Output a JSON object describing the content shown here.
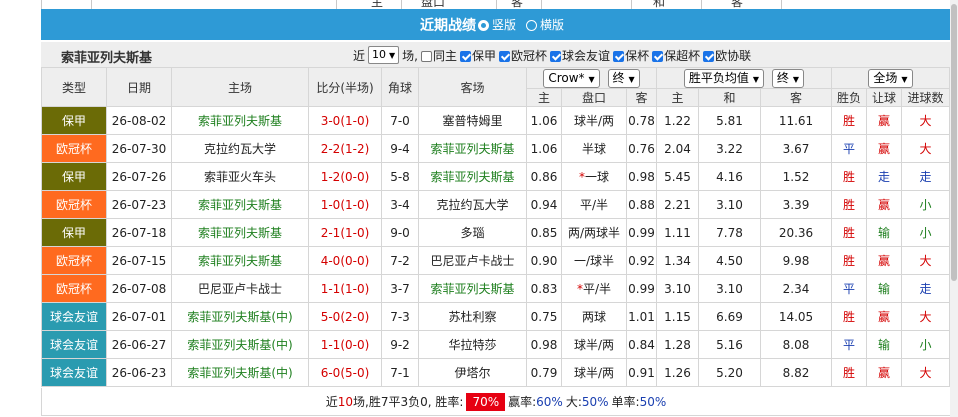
{
  "top_stub": {
    "labels": [
      "主",
      "盘口",
      "客",
      "和",
      "客"
    ]
  },
  "title_bar": {
    "title": "近期战绩",
    "option_vertical": "竖版",
    "option_horizontal": "横版"
  },
  "header": {
    "team": "索菲亚列夫斯基",
    "recent_label": "近",
    "count_value": "10",
    "count_unit": "场,",
    "checkboxes": [
      {
        "label": "同主",
        "checked": false
      },
      {
        "label": "保甲",
        "checked": true
      },
      {
        "label": "欧冠杯",
        "checked": true
      },
      {
        "label": "球会友谊",
        "checked": true
      },
      {
        "label": "保杯",
        "checked": true
      },
      {
        "label": "保超杯",
        "checked": true
      },
      {
        "label": "欧协联",
        "checked": false
      }
    ]
  },
  "columns": {
    "type": "类型",
    "date": "日期",
    "home": "主场",
    "score": "比分(半场)",
    "corner": "角球",
    "away": "客场",
    "company_select": "Crow*",
    "ah_time_select": "终",
    "euro_select": "胜平负均值",
    "euro_time_select": "终",
    "scope_select": "全场",
    "ah_home": "主",
    "ah_line": "盘口",
    "ah_away": "客",
    "eu_home": "主",
    "eu_draw": "和",
    "eu_away": "客",
    "result": "胜负",
    "handicap_result": "让球",
    "goals": "进球数"
  },
  "rows": [
    {
      "league": "保甲",
      "league_color": "#6b6b06",
      "date": "26-08-02",
      "home": "索菲亚列夫斯基",
      "home_green": true,
      "score": "3-0(1-0)",
      "corner": "7-0",
      "away": "塞普特姆里",
      "away_green": false,
      "ah_h": "1.06",
      "ah_line": "球半/两",
      "ah_star": false,
      "ah_a": "0.78",
      "eu_h": "1.22",
      "eu_d": "5.81",
      "eu_a": "11.61",
      "res": "胜",
      "hc": "赢",
      "ou": "大"
    },
    {
      "league": "欧冠杯",
      "league_color": "#ff6a1f",
      "date": "26-07-30",
      "home": "克拉约瓦大学",
      "home_green": false,
      "score": "2-2(1-2)",
      "corner": "9-4",
      "away": "索菲亚列夫斯基",
      "away_green": true,
      "ah_h": "1.06",
      "ah_line": "半球",
      "ah_star": false,
      "ah_a": "0.76",
      "eu_h": "2.04",
      "eu_d": "3.22",
      "eu_a": "3.67",
      "res": "平",
      "hc": "赢",
      "ou": "大"
    },
    {
      "league": "保甲",
      "league_color": "#6b6b06",
      "date": "26-07-26",
      "home": "索菲亚火车头",
      "home_green": false,
      "score": "1-2(0-0)",
      "corner": "5-8",
      "away": "索菲亚列夫斯基",
      "away_green": true,
      "ah_h": "0.86",
      "ah_line": "一球",
      "ah_star": true,
      "ah_a": "0.98",
      "eu_h": "5.45",
      "eu_d": "4.16",
      "eu_a": "1.52",
      "res": "胜",
      "hc": "走",
      "ou": "走"
    },
    {
      "league": "欧冠杯",
      "league_color": "#ff6a1f",
      "date": "26-07-23",
      "home": "索菲亚列夫斯基",
      "home_green": true,
      "score": "1-0(1-0)",
      "corner": "3-4",
      "away": "克拉约瓦大学",
      "away_green": false,
      "ah_h": "0.94",
      "ah_line": "平/半",
      "ah_star": false,
      "ah_a": "0.88",
      "eu_h": "2.21",
      "eu_d": "3.10",
      "eu_a": "3.39",
      "res": "胜",
      "hc": "赢",
      "ou": "小"
    },
    {
      "league": "保甲",
      "league_color": "#6b6b06",
      "date": "26-07-18",
      "home": "索菲亚列夫斯基",
      "home_green": true,
      "score": "2-1(1-0)",
      "corner": "9-0",
      "away": "多瑙",
      "away_green": false,
      "ah_h": "0.85",
      "ah_line": "两/两球半",
      "ah_star": false,
      "ah_a": "0.99",
      "eu_h": "1.11",
      "eu_d": "7.78",
      "eu_a": "20.36",
      "res": "胜",
      "hc": "输",
      "ou": "小"
    },
    {
      "league": "欧冠杯",
      "league_color": "#ff6a1f",
      "date": "26-07-15",
      "home": "索菲亚列夫斯基",
      "home_green": true,
      "score": "4-0(0-0)",
      "corner": "7-2",
      "away": "巴尼亚卢卡战士",
      "away_green": false,
      "ah_h": "0.90",
      "ah_line": "一/球半",
      "ah_star": false,
      "ah_a": "0.92",
      "eu_h": "1.34",
      "eu_d": "4.50",
      "eu_a": "9.98",
      "res": "胜",
      "hc": "赢",
      "ou": "大"
    },
    {
      "league": "欧冠杯",
      "league_color": "#ff6a1f",
      "date": "26-07-08",
      "home": "巴尼亚卢卡战士",
      "home_green": false,
      "score": "1-1(1-0)",
      "corner": "3-7",
      "away": "索菲亚列夫斯基",
      "away_green": true,
      "ah_h": "0.83",
      "ah_line": "平/半",
      "ah_star": true,
      "ah_a": "0.99",
      "eu_h": "3.10",
      "eu_d": "3.10",
      "eu_a": "2.34",
      "res": "平",
      "hc": "输",
      "ou": "走"
    },
    {
      "league": "球会友谊",
      "league_color": "#2a9bb0",
      "date": "26-07-01",
      "home": "索菲亚列夫斯基(中)",
      "home_green": true,
      "score": "5-0(2-0)",
      "corner": "7-3",
      "away": "苏杜利察",
      "away_green": false,
      "ah_h": "0.75",
      "ah_line": "两球",
      "ah_star": false,
      "ah_a": "1.01",
      "eu_h": "1.15",
      "eu_d": "6.69",
      "eu_a": "14.05",
      "res": "胜",
      "hc": "赢",
      "ou": "大"
    },
    {
      "league": "球会友谊",
      "league_color": "#2a9bb0",
      "date": "26-06-27",
      "home": "索菲亚列夫斯基(中)",
      "home_green": true,
      "score": "1-1(0-0)",
      "corner": "9-2",
      "away": "华拉特莎",
      "away_green": false,
      "ah_h": "0.98",
      "ah_line": "球半/两",
      "ah_star": false,
      "ah_a": "0.84",
      "eu_h": "1.28",
      "eu_d": "5.16",
      "eu_a": "8.08",
      "res": "平",
      "hc": "输",
      "ou": "小"
    },
    {
      "league": "球会友谊",
      "league_color": "#2a9bb0",
      "date": "26-06-23",
      "home": "索菲亚列夫斯基(中)",
      "home_green": true,
      "score": "6-0(5-0)",
      "corner": "7-1",
      "away": "伊塔尔",
      "away_green": false,
      "ah_h": "0.79",
      "ah_line": "球半/两",
      "ah_star": false,
      "ah_a": "0.91",
      "eu_h": "1.26",
      "eu_d": "5.20",
      "eu_a": "8.82",
      "res": "胜",
      "hc": "赢",
      "ou": "大"
    }
  ],
  "footer": {
    "prefix": "近",
    "count": "10",
    "summary": "场,胜7平3负0, 胜率:",
    "win_rate": "70%",
    "hc_label": "赢率:",
    "hc_rate": "60%",
    "big_label": "大:",
    "big_rate": "50%",
    "odd_label": "单率:",
    "odd_rate": "50%"
  }
}
